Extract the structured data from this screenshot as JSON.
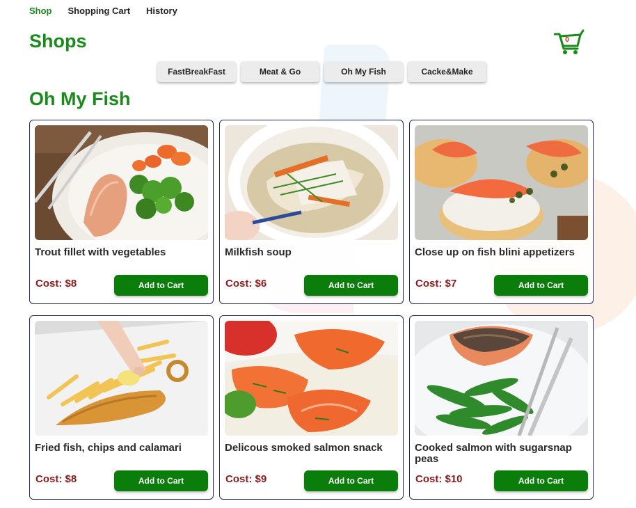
{
  "nav": {
    "items": [
      {
        "label": "Shop",
        "active": true
      },
      {
        "label": "Shopping Cart",
        "active": false
      },
      {
        "label": "History",
        "active": false
      }
    ]
  },
  "page_title": "Shops",
  "cart": {
    "count": "0",
    "icon": "shopping-cart-icon"
  },
  "shop_tabs": [
    "FastBreakFast",
    "Meat & Go",
    "Oh My Fish",
    "Cacke&Make"
  ],
  "section_title": "Oh My Fish",
  "products": [
    {
      "name": "Trout fillet with vegetables",
      "cost": "Cost: $8",
      "button": "Add to Cart"
    },
    {
      "name": "Milkfish soup",
      "cost": "Cost: $6",
      "button": "Add to Cart"
    },
    {
      "name": "Close up on fish blini appetizers",
      "cost": "Cost: $7",
      "button": "Add to Cart"
    },
    {
      "name": "Fried fish, chips and calamari",
      "cost": "Cost: $8",
      "button": "Add to Cart"
    },
    {
      "name": "Delicous smoked salmon snack",
      "cost": "Cost: $9",
      "button": "Add to Cart"
    },
    {
      "name": "Cooked salmon with sugarsnap peas",
      "cost": "Cost: $10",
      "button": "Add to Cart"
    }
  ],
  "colors": {
    "accent_green": "#1a8a1a",
    "button_green": "#0a7d0a",
    "price_red": "#8b1a1a",
    "card_border": "#1f2a6a"
  }
}
